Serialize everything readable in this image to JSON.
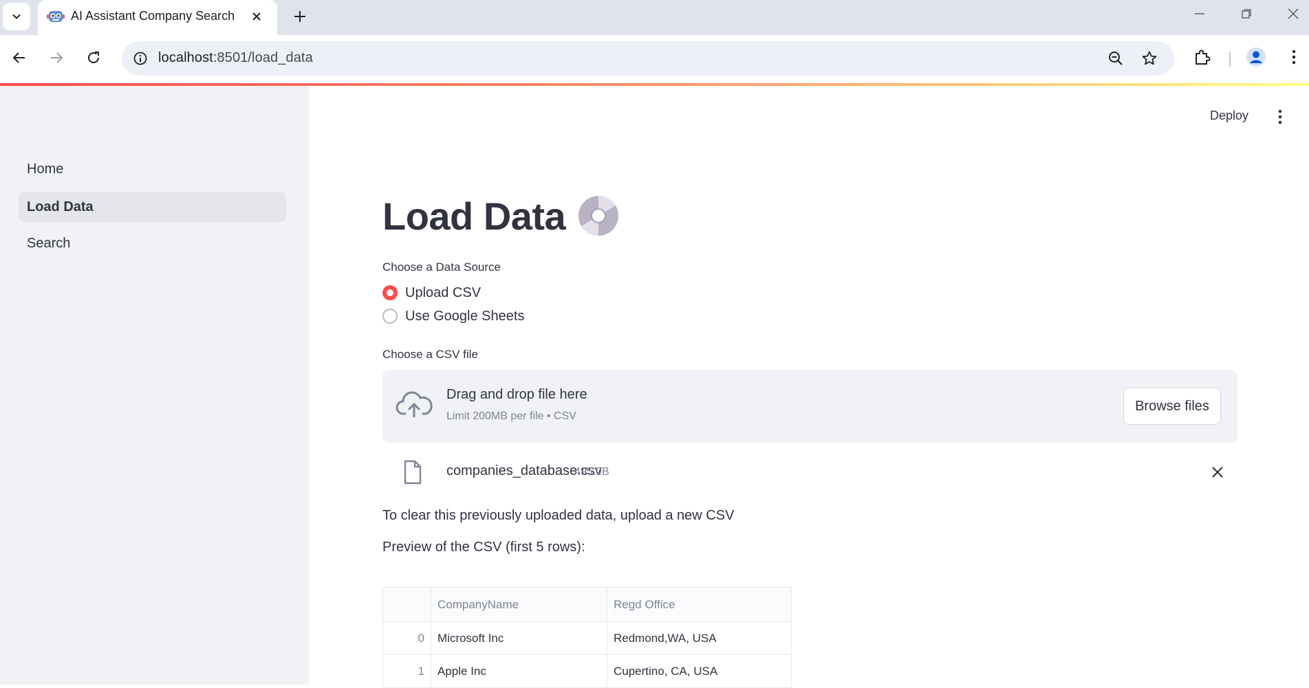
{
  "browser": {
    "tab_title": "AI Assistant Company Search",
    "url_host": "localhost",
    "url_rest": ":8501/load_data"
  },
  "sidebar": {
    "items": [
      {
        "label": "Home",
        "active": false
      },
      {
        "label": "Load Data",
        "active": true
      },
      {
        "label": "Search",
        "active": false
      }
    ]
  },
  "header": {
    "deploy_label": "Deploy"
  },
  "page": {
    "title": "Load Data",
    "data_source_label": "Choose a Data Source",
    "data_source_options": [
      "Upload CSV",
      "Use Google Sheets"
    ],
    "data_source_selected": "Upload CSV",
    "csv_label": "Choose a CSV file",
    "dropzone_title": "Drag and drop file here",
    "dropzone_limit": "Limit 200MB per file • CSV",
    "browse_label": "Browse files",
    "uploaded_file_name": "companies_database.csv",
    "uploaded_file_size": "495.0B",
    "clear_note": "To clear this previously uploaded data, upload a new CSV",
    "preview_label": "Preview of the CSV (first 5 rows):"
  },
  "table": {
    "columns": [
      "",
      "CompanyName",
      "Regd Office"
    ],
    "rows": [
      [
        "0",
        "Microsoft Inc",
        "Redmond,WA, USA"
      ],
      [
        "1",
        "Apple Inc",
        "Cupertino, CA, USA"
      ]
    ]
  },
  "colors": {
    "accent": "#ff4b4b",
    "sidebar_bg": "#f0f2f6",
    "text": "#31333f"
  }
}
